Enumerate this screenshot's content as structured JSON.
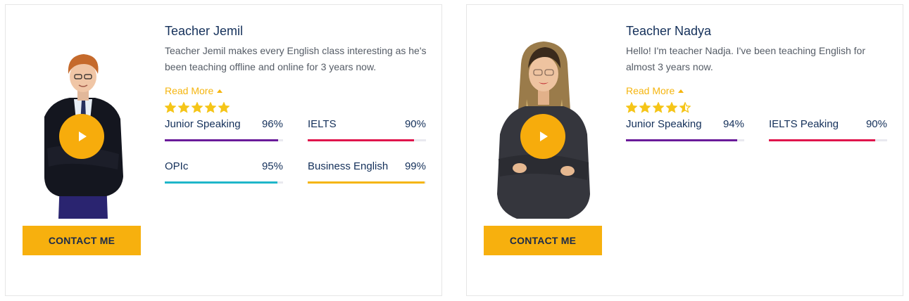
{
  "teachers": [
    {
      "name": "Teacher Jemil",
      "bio": "Teacher Jemil makes every English class interesting as he's been teaching offline and online for 3 years now.",
      "read_more": "Read More",
      "rating": 5,
      "contact_label": "CONTACT ME",
      "skills": [
        {
          "label": "Junior Speaking",
          "value": "96%",
          "percent": 96,
          "color": "#6a1b9a"
        },
        {
          "label": "IELTS",
          "value": "90%",
          "percent": 90,
          "color": "#e0144c"
        },
        {
          "label": "OPIc",
          "value": "95%",
          "percent": 95,
          "color": "#1fb6c9"
        },
        {
          "label": "Business English",
          "value": "99%",
          "percent": 99,
          "color": "#f5b50f"
        }
      ]
    },
    {
      "name": "Teacher Nadya",
      "bio": "Hello! I'm teacher Nadja. I've been teaching English for almost 3 years now.",
      "read_more": "Read More",
      "rating": 4.5,
      "contact_label": "CONTACT ME",
      "skills": [
        {
          "label": "Junior Speaking",
          "value": "94%",
          "percent": 94,
          "color": "#6a1b9a"
        },
        {
          "label": "IELTS Peaking",
          "value": "90%",
          "percent": 90,
          "color": "#e0144c"
        }
      ]
    }
  ],
  "colors": {
    "accent": "#f7ac0c",
    "star": "#f5c518",
    "heading": "#14305a"
  }
}
